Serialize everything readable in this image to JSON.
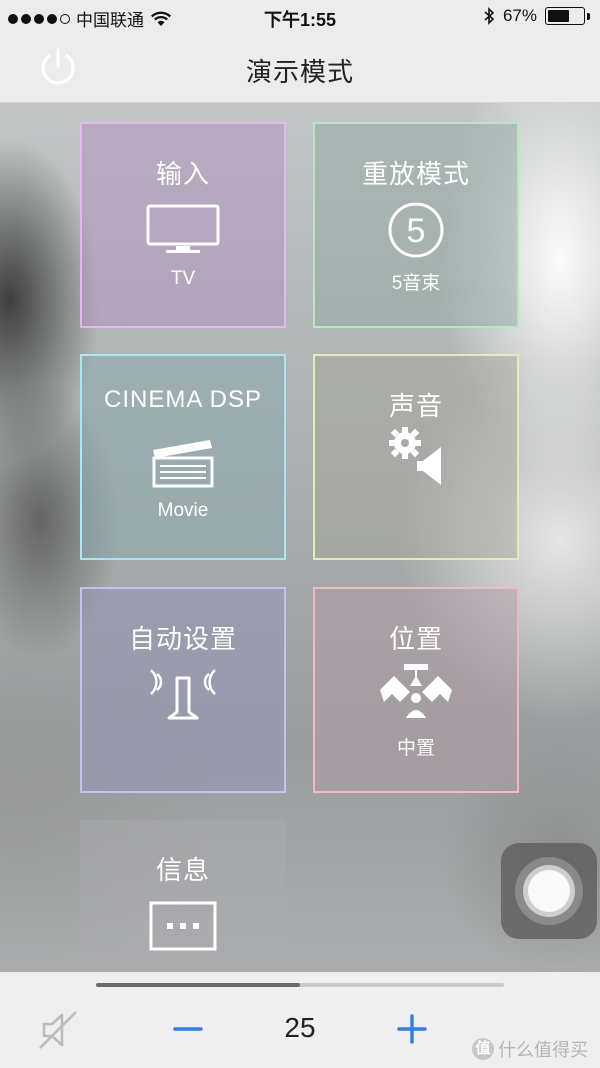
{
  "status_bar": {
    "carrier": "中国联通",
    "time": "下午1:55",
    "battery": "67%",
    "battery_level": 0.67
  },
  "nav": {
    "title": "演示模式"
  },
  "tiles": [
    {
      "title": "输入",
      "subtitle": "TV",
      "icon": "tv-icon"
    },
    {
      "title": "重放模式",
      "subtitle": "5音束",
      "icon": "circled-number-icon",
      "icon_text": "5"
    },
    {
      "title": "CINEMA DSP",
      "subtitle": "Movie",
      "icon": "clapperboard-icon"
    },
    {
      "title": "声音",
      "subtitle": "",
      "icon": "gear-speaker-icon"
    },
    {
      "title": "自动设置",
      "subtitle": "",
      "icon": "microphone-waves-icon"
    },
    {
      "title": "位置",
      "subtitle": "中置",
      "icon": "position-center-icon"
    },
    {
      "title": "信息",
      "subtitle": "",
      "icon": "info-box-icon"
    }
  ],
  "volume": {
    "value": "25",
    "level": 0.5,
    "minus_label": "−",
    "plus_label": "+"
  },
  "watermark": {
    "badge": "值",
    "text": "什么值得买"
  },
  "colors": {
    "tile_input_border": "#e7b8ee",
    "tile_replay_border": "#b9e6bf",
    "tile_cinema_border": "#a8e7ef",
    "tile_sound_border": "#e3ecb3",
    "tile_auto_border": "#c0c3f1",
    "tile_position_border": "#f0b9c4",
    "accent_blue": "#2f7fe0"
  }
}
